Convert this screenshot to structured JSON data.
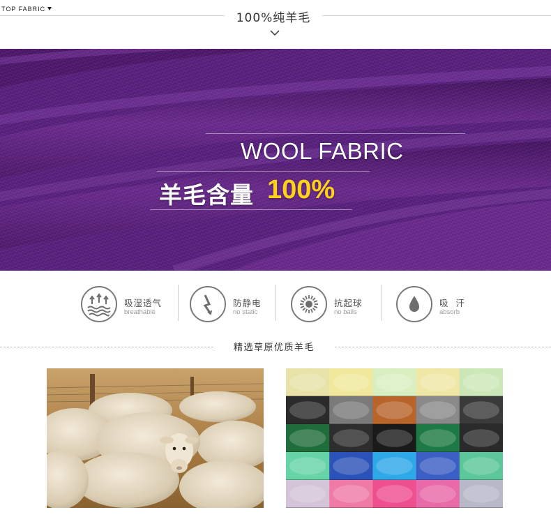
{
  "header": {
    "top_fabric_label": "TOP FABRIC",
    "title": "100%纯羊毛",
    "chevron_icon": "chevron-down-icon"
  },
  "hero": {
    "english_title": "WOOL FABRIC",
    "chinese_label": "羊毛含量",
    "percent": "100%",
    "colors": {
      "background": "#5a1f7a",
      "highlight": "#ffd21a"
    }
  },
  "features": [
    {
      "icon": "breathable-icon",
      "label_cn": "吸湿透气",
      "label_en": "breathable"
    },
    {
      "icon": "no-static-icon",
      "label_cn": "防静电",
      "label_en": "no static"
    },
    {
      "icon": "no-balls-icon",
      "label_cn": "抗起球",
      "label_en": "no balls"
    },
    {
      "icon": "absorb-icon",
      "label_cn": "吸  汗",
      "label_en": "absorb"
    }
  ],
  "section": {
    "title": "精选草原优质羊毛"
  },
  "photos": [
    {
      "icon": "sheep-photo"
    },
    {
      "icon": "wool-yarn-photo"
    }
  ]
}
